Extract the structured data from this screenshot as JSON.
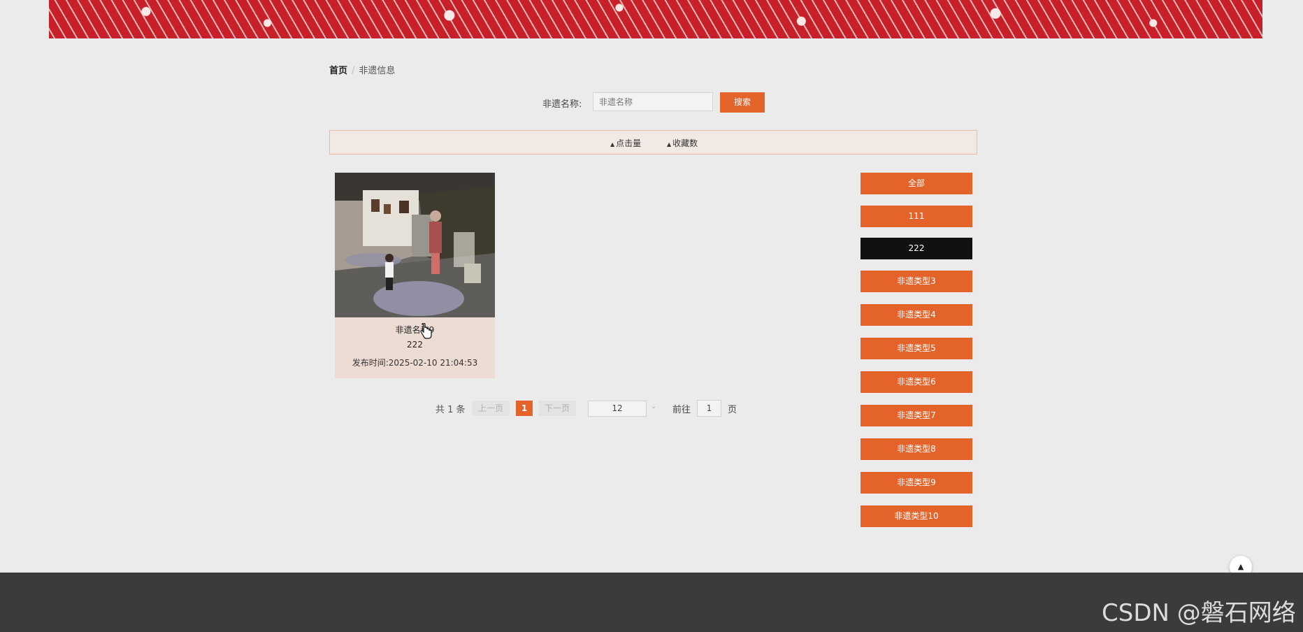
{
  "breadcrumb": {
    "home": "首页",
    "separator": "/",
    "current": "非遗信息"
  },
  "search": {
    "label": "非遗名称:",
    "placeholder": "非遗名称",
    "button": "搜索"
  },
  "sort": {
    "items": [
      "点击量",
      "收藏数"
    ],
    "arrow_icon": "sort-icon"
  },
  "card": {
    "title": "非遗名称9",
    "type": "222",
    "date_label": "发布时间:",
    "date": "2025-02-10 21:04:53"
  },
  "pagination": {
    "total_text": "共 1 条",
    "prev": "上一页",
    "current": "1",
    "next": "下一页",
    "page_size": "12",
    "goto_label": "前往",
    "goto_value": "1",
    "page_label": "页"
  },
  "categories": {
    "items": [
      "全部",
      "111",
      "222",
      "非遗类型3",
      "非遗类型4",
      "非遗类型5",
      "非遗类型6",
      "非遗类型7",
      "非遗类型8",
      "非遗类型9",
      "非遗类型10"
    ],
    "active": "222"
  },
  "watermark": "CSDN @磐石网络",
  "colors": {
    "accent": "#e3632a",
    "active": "#111111",
    "footer": "#3b3b3b",
    "banner_red": "#c8202b"
  }
}
